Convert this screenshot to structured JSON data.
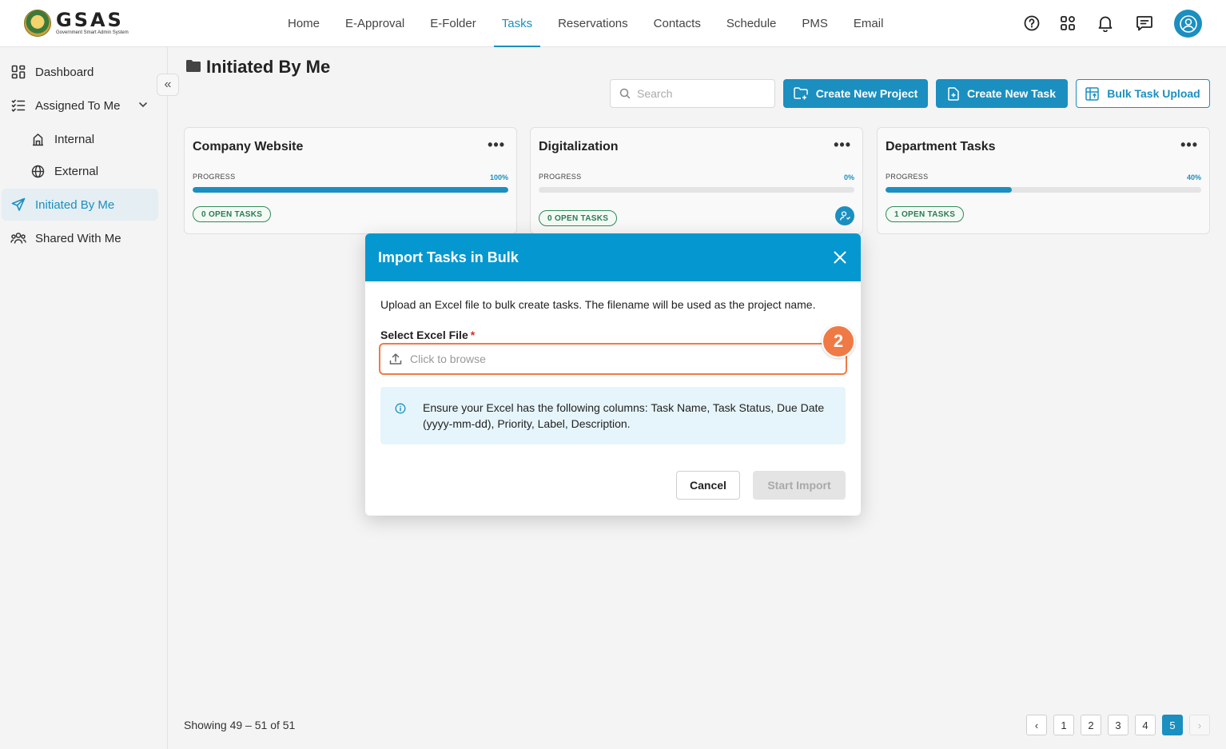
{
  "app": {
    "logo_text": "GSAS",
    "logo_subtitle": "Government Smart Admin System"
  },
  "nav": {
    "items": [
      {
        "label": "Home"
      },
      {
        "label": "E-Approval"
      },
      {
        "label": "E-Folder"
      },
      {
        "label": "Tasks",
        "active": true
      },
      {
        "label": "Reservations"
      },
      {
        "label": "Contacts"
      },
      {
        "label": "Schedule"
      },
      {
        "label": "PMS"
      },
      {
        "label": "Email"
      }
    ],
    "icons": [
      "help-icon",
      "apps-grid-icon",
      "bell-icon",
      "chat-icon",
      "user-avatar-icon"
    ]
  },
  "sidebar": {
    "items": [
      {
        "label": "Dashboard",
        "icon": "dashboard-icon"
      },
      {
        "label": "Assigned To Me",
        "icon": "checklist-icon"
      },
      {
        "label": "Internal",
        "icon": "building-icon"
      },
      {
        "label": "External",
        "icon": "globe-icon"
      },
      {
        "label": "Initiated By Me",
        "icon": "send-icon",
        "active": true
      },
      {
        "label": "Shared With Me",
        "icon": "users-icon"
      }
    ],
    "collapse_label": "«"
  },
  "page": {
    "title": "Initiated By Me",
    "search_placeholder": "Search",
    "buttons": {
      "create_project": "Create New Project",
      "create_task": "Create New Task",
      "bulk_upload": "Bulk Task Upload"
    }
  },
  "projects": [
    {
      "name": "Company Website",
      "progress_label": "PROGRESS",
      "progress_text": "100%",
      "progress": 1.0,
      "open_tasks": "0 OPEN TASKS"
    },
    {
      "name": "Digitalization",
      "progress_label": "PROGRESS",
      "progress_text": "0%",
      "progress": 0.0,
      "open_tasks": "0 OPEN TASKS"
    },
    {
      "name": "Department Tasks",
      "progress_label": "PROGRESS",
      "progress_text": "40%",
      "progress": 0.4,
      "open_tasks": "1 OPEN TASKS"
    }
  ],
  "card_menu": "•••",
  "pagination": {
    "showing": "Showing 49 – 51 of 51",
    "prev": "‹",
    "next": "›",
    "pages": [
      "1",
      "2",
      "3",
      "4",
      "5"
    ],
    "current": "5"
  },
  "modal": {
    "title": "Import Tasks in Bulk",
    "description": "Upload an Excel file to bulk create tasks. The filename will be used as the project name.",
    "field_label": "Select Excel File",
    "required_mark": "*",
    "file_placeholder": "Click to browse",
    "step_marker": "2",
    "info_text": "Ensure your Excel has the following columns: Task Name, Task Status, Due Date (yyyy-mm-dd), Priority, Label, Description.",
    "cancel_label": "Cancel",
    "start_label": "Start Import"
  },
  "colors": {
    "accent": "#1b8fc0",
    "modal_header": "#0598d0",
    "highlight": "#f07a45",
    "badge_green": "#2e8b57",
    "info_bg": "#e6f5fb"
  }
}
